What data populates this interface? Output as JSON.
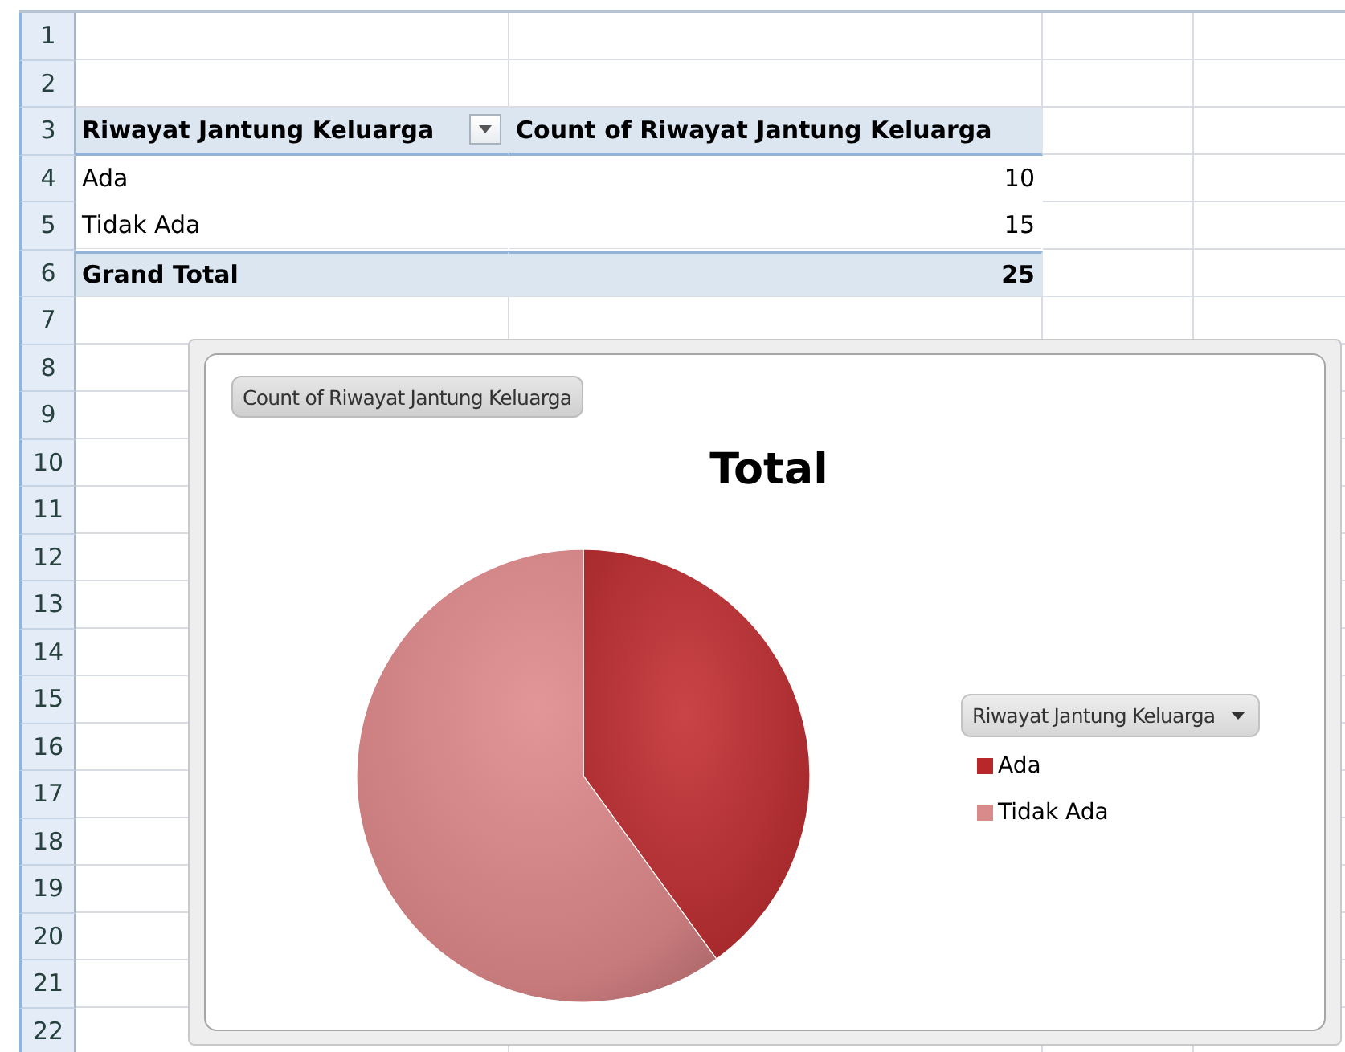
{
  "sheet": {
    "row_numbers": [
      "1",
      "2",
      "3",
      "4",
      "5",
      "6",
      "7",
      "8",
      "9",
      "10",
      "11",
      "12",
      "13",
      "14",
      "15",
      "16",
      "17",
      "18",
      "19",
      "20",
      "21",
      "22"
    ],
    "pivot": {
      "headers": [
        "Riwayat Jantung Keluarga",
        "Count of Riwayat Jantung Keluarga"
      ],
      "rows": [
        {
          "label": "Ada",
          "value": "10"
        },
        {
          "label": "Tidak Ada",
          "value": "15"
        }
      ],
      "total": {
        "label": "Grand Total",
        "value": "25"
      }
    }
  },
  "chart": {
    "field_button": "Count of Riwayat Jantung Keluarga",
    "legend_field": "Riwayat Jantung Keluarga",
    "chart_data": {
      "type": "pie",
      "title": "Total",
      "categories": [
        "Ada",
        "Tidak Ada"
      ],
      "series": [
        {
          "values": [
            40,
            60
          ]
        }
      ],
      "legend": "right"
    }
  }
}
